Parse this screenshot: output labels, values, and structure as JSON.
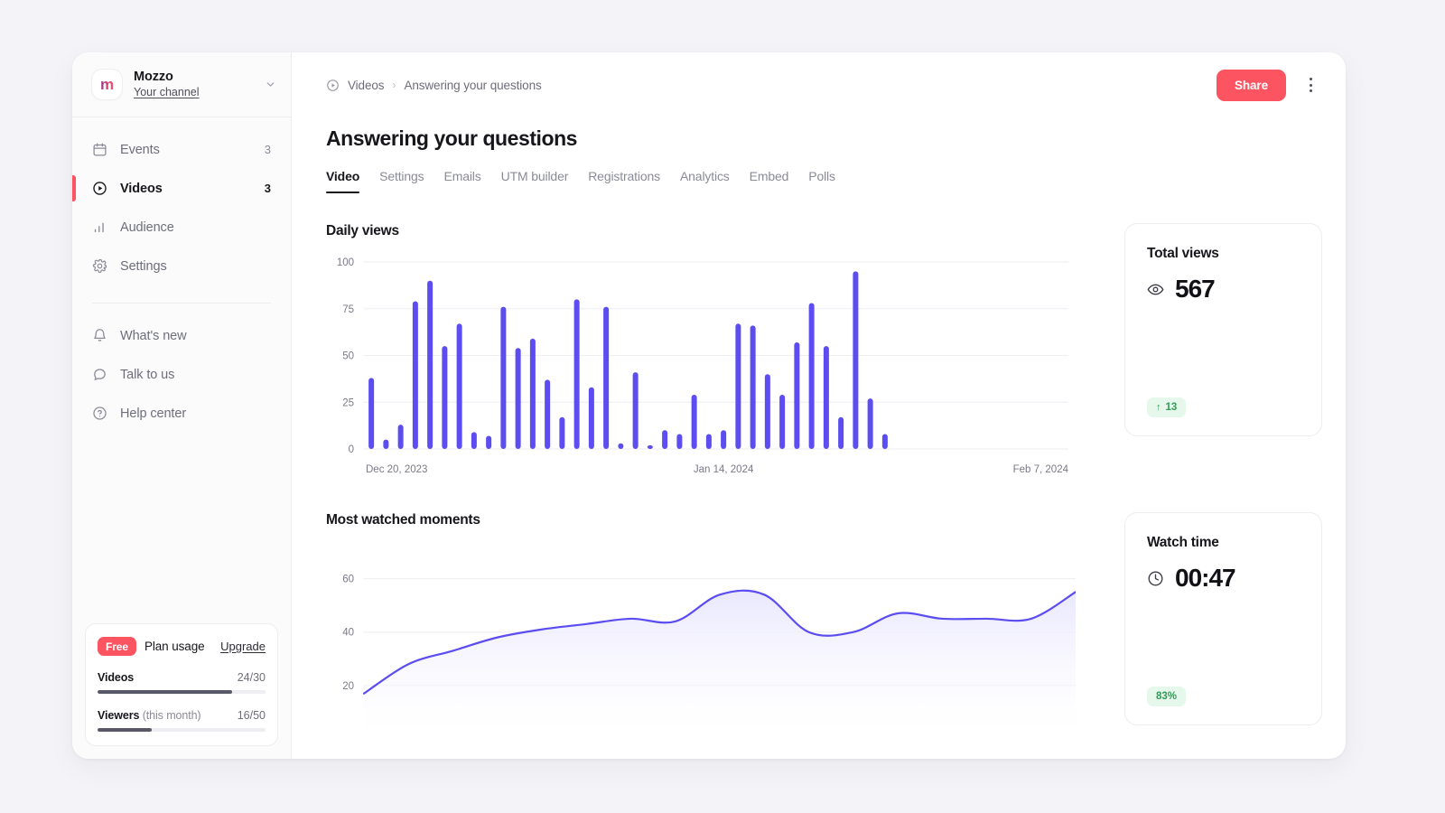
{
  "brand": {
    "name": "Mozzo",
    "subtitle": "Your channel",
    "logo_letter": "m",
    "chevron_icon": "chevron-down-icon",
    "accent_pink": "#fc5460",
    "accent_purple": "#5b4df0"
  },
  "sidebar": {
    "items": [
      {
        "label": "Events",
        "count": "3",
        "icon": "calendar-icon",
        "active": false
      },
      {
        "label": "Videos",
        "count": "3",
        "icon": "play-circle-icon",
        "active": true
      },
      {
        "label": "Audience",
        "count": "",
        "icon": "bar-chart-icon",
        "active": false
      },
      {
        "label": "Settings",
        "count": "",
        "icon": "gear-icon",
        "active": false
      }
    ],
    "secondary_items": [
      {
        "label": "What's new",
        "icon": "bell-icon"
      },
      {
        "label": "Talk to us",
        "icon": "chat-bubble-icon"
      },
      {
        "label": "Help center",
        "icon": "question-circle-icon"
      }
    ],
    "plan": {
      "badge": "Free",
      "title": "Plan usage",
      "upgrade": "Upgrade",
      "usage": [
        {
          "name": "Videos",
          "note": "",
          "value": "24/30",
          "percent": 80
        },
        {
          "name": "Viewers",
          "note": " (this month)",
          "value": "16/50",
          "percent": 32
        }
      ]
    }
  },
  "header": {
    "breadcrumb": {
      "icon": "play-circle-icon",
      "parent": "Videos",
      "separator": "›",
      "current": "Answering your questions"
    },
    "share_label": "Share",
    "menu_icon": "kebab-menu-icon"
  },
  "page": {
    "title": "Answering your questions",
    "tabs": [
      {
        "label": "Video",
        "active": true
      },
      {
        "label": "Settings",
        "active": false
      },
      {
        "label": "Emails",
        "active": false
      },
      {
        "label": "UTM builder",
        "active": false
      },
      {
        "label": "Registrations",
        "active": false
      },
      {
        "label": "Analytics",
        "active": false
      },
      {
        "label": "Embed",
        "active": false
      },
      {
        "label": "Polls",
        "active": false
      }
    ]
  },
  "stats": [
    {
      "title": "Total views",
      "icon": "eye-icon",
      "value": "567",
      "chip_arrow": "↑",
      "chip_value": "13"
    },
    {
      "title": "Watch time",
      "icon": "clock-icon",
      "value": "00:47",
      "chip_arrow": "",
      "chip_value": "83%"
    }
  ],
  "chart_data": [
    {
      "type": "bar",
      "title": "Daily views",
      "xlabel": "",
      "ylabel": "",
      "ylim": [
        0,
        100
      ],
      "yticks": [
        0,
        25,
        50,
        75,
        100
      ],
      "ytick_labels": [
        "0",
        "25",
        "50",
        "75",
        "100"
      ],
      "grid": true,
      "legend": "none",
      "bar_color": "#5b4df0",
      "xtick_labels": [
        "Dec 20, 2023",
        "Jan 14, 2024",
        "Feb 7, 2024"
      ],
      "xtick_positions": [
        0,
        24,
        47
      ],
      "categories": [
        "1",
        "2",
        "3",
        "4",
        "5",
        "6",
        "7",
        "8",
        "9",
        "10",
        "11",
        "12",
        "13",
        "14",
        "15",
        "16",
        "17",
        "18",
        "19",
        "20",
        "21",
        "22",
        "23",
        "24",
        "25",
        "26",
        "27",
        "28",
        "29",
        "30",
        "31",
        "32",
        "33",
        "34",
        "35",
        "36",
        "37",
        "38",
        "39",
        "40",
        "41",
        "42",
        "43",
        "44",
        "45",
        "46",
        "47",
        "48"
      ],
      "values": [
        38,
        5,
        13,
        79,
        90,
        55,
        67,
        9,
        7,
        76,
        54,
        59,
        37,
        17,
        80,
        33,
        76,
        3,
        41,
        2,
        10,
        8,
        29,
        8,
        10,
        67,
        66,
        40,
        29,
        57,
        78,
        55,
        17,
        95,
        27,
        8,
        0,
        0,
        0,
        0,
        0,
        0,
        0,
        0,
        0,
        0,
        0,
        0
      ]
    },
    {
      "type": "area",
      "title": "Most watched moments",
      "xlabel": "",
      "ylabel": "",
      "ylim": [
        0,
        70
      ],
      "yticks": [
        20,
        40,
        60
      ],
      "ytick_labels": [
        "20",
        "40",
        "60"
      ],
      "grid": true,
      "legend": "none",
      "line_color": "#5b4df0",
      "fill_color": "#e9e7fd",
      "x": [
        0,
        1,
        2,
        3,
        4,
        5,
        6,
        7,
        8,
        9,
        10,
        11,
        12,
        13,
        14,
        15,
        16
      ],
      "values": [
        17,
        28,
        33,
        38,
        41,
        43,
        45,
        44,
        54,
        54,
        40,
        40,
        47,
        45,
        45,
        45,
        55
      ]
    }
  ]
}
